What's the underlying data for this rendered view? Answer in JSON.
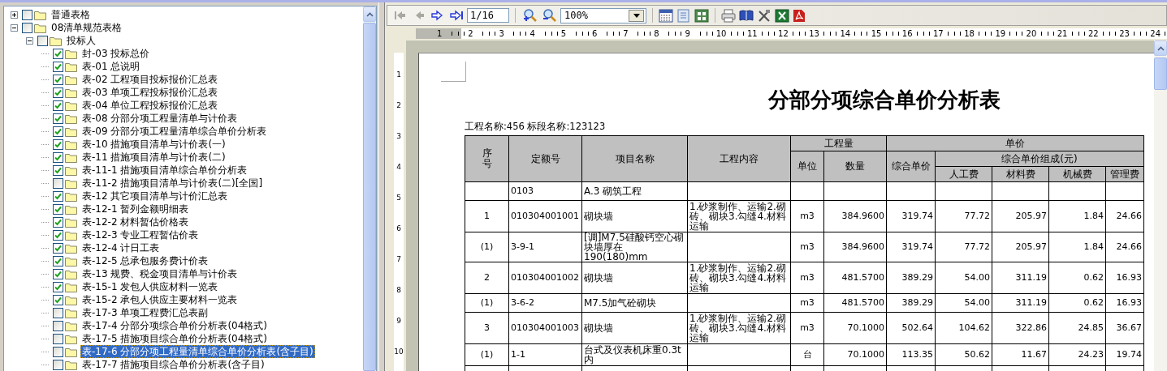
{
  "tree": {
    "items": [
      {
        "label": "普通表格",
        "expanded": false,
        "checked": false,
        "selected": false
      },
      {
        "label": "08清单规范表格",
        "expanded": true,
        "checked": false,
        "selected": false,
        "children": [
          {
            "label": "投标人",
            "expanded": true,
            "checked": false,
            "selected": false,
            "children": [
              {
                "label": "封-03 投标总价",
                "checked": true,
                "selected": false
              },
              {
                "label": "表-01 总说明",
                "checked": true,
                "selected": false
              },
              {
                "label": "表-02 工程项目投标报价汇总表",
                "checked": true,
                "selected": false
              },
              {
                "label": "表-03 单项工程投标报价汇总表",
                "checked": true,
                "selected": false
              },
              {
                "label": "表-04 单位工程投标报价汇总表",
                "checked": true,
                "selected": false
              },
              {
                "label": "表-08 分部分项工程量清单与计价表",
                "checked": true,
                "selected": false
              },
              {
                "label": "表-09 分部分项工程量清单综合单价分析表",
                "checked": true,
                "selected": false
              },
              {
                "label": "表-10 措施项目清单与计价表(一)",
                "checked": true,
                "selected": false
              },
              {
                "label": "表-11 措施项目清单与计价表(二)",
                "checked": true,
                "selected": false
              },
              {
                "label": "表-11-1 措施项目清单综合单价分析表",
                "checked": true,
                "selected": false
              },
              {
                "label": "表-11-2 措施项目清单与计价表(二)[全国]",
                "checked": false,
                "selected": false
              },
              {
                "label": "表-12 其它项目清单与计价汇总表",
                "checked": true,
                "selected": false
              },
              {
                "label": "表-12-1 暂列金额明细表",
                "checked": true,
                "selected": false
              },
              {
                "label": "表-12-2 材料暂估价格表",
                "checked": true,
                "selected": false
              },
              {
                "label": "表-12-3 专业工程暂估价表",
                "checked": true,
                "selected": false
              },
              {
                "label": "表-12-4 计日工表",
                "checked": true,
                "selected": false
              },
              {
                "label": "表-12-5 总承包服务费计价表",
                "checked": true,
                "selected": false
              },
              {
                "label": "表-13 规费、税金项目清单与计价表",
                "checked": true,
                "selected": false
              },
              {
                "label": "表-15-1 发包人供应材料一览表",
                "checked": true,
                "selected": false
              },
              {
                "label": "表-15-2 承包人供应主要材料一览表",
                "checked": true,
                "selected": false
              },
              {
                "label": "表-17-3 单项工程费汇总表副",
                "checked": false,
                "selected": false
              },
              {
                "label": "表-17-4 分部分项综合单价分析表(04格式)",
                "checked": false,
                "selected": false
              },
              {
                "label": "表-17-5 措施项目综合单价分析表(04格式)",
                "checked": false,
                "selected": false
              },
              {
                "label": "表-17-6 分部分项工程量清单综合单价分析表(含子目)",
                "checked": false,
                "selected": true
              },
              {
                "label": "表-17-7 措施项目综合单价分析表(含子目)",
                "checked": false,
                "selected": false
              }
            ]
          }
        ]
      }
    ]
  },
  "toolbar": {
    "nav_buttons": [
      {
        "disabled": true
      },
      {
        "disabled": true
      },
      {
        "disabled": false
      },
      {
        "disabled": false
      }
    ],
    "page_field": {
      "value": "1/16"
    },
    "zoom_select": {
      "value": "100%"
    }
  },
  "ruler": {
    "marks": [
      "1",
      "2",
      "3",
      "4",
      "5",
      "6",
      "7",
      "8",
      "9",
      "10",
      "11",
      "12",
      "13",
      "14",
      "15",
      "16",
      "17",
      "18",
      "19",
      "20",
      "21",
      "22",
      "23",
      "24"
    ]
  },
  "vertical_ruler": {
    "marks": [
      "1",
      "2",
      "3",
      "4",
      "5",
      "6",
      "7",
      "8",
      "9",
      "10"
    ]
  },
  "report": {
    "title": "分部分项综合单价分析表",
    "info": "工程名称:456 标段名称:123123",
    "columns": [
      {
        "label": "序号"
      },
      {
        "label": "定额号"
      },
      {
        "label": "项目名称"
      },
      {
        "label": "工程内容"
      },
      {
        "label": "工程量",
        "children": [
          {
            "label": "单位"
          },
          {
            "label": "数量"
          }
        ]
      },
      {
        "label": "单价",
        "children": [
          {
            "label": "综合单价"
          },
          {
            "label": "综合单价组成(元)",
            "children": [
              {
                "label": "人工费"
              },
              {
                "label": "材料费"
              },
              {
                "label": "机械费"
              },
              {
                "label": "管理费"
              }
            ]
          }
        ]
      }
    ],
    "rows": [
      {
        "code": "0103",
        "name": "A.3 砌筑工程"
      },
      {
        "seq": "1",
        "code": "010304001001",
        "name": "砌块墙",
        "content": "1.砂浆制作、运输2.砌砖、砌块3.勾缝4.材料运输",
        "unit": "m3",
        "qty": "384.9600",
        "price": "319.74",
        "labor": "77.72",
        "material": "205.97",
        "machine": "1.84",
        "mgmt": "24.66"
      },
      {
        "seq": "(1)",
        "code": "3-9-1",
        "name": "[调]M7.5硅酸钙空心砌块墙厚在190(180)mm",
        "unit": "m3",
        "qty": "384.9600",
        "price": "319.74",
        "labor": "77.72",
        "material": "205.97",
        "machine": "1.84",
        "mgmt": "24.66"
      },
      {
        "seq": "2",
        "code": "010304001002",
        "name": "砌块墙",
        "content": "1.砂浆制作、运输2.砌砖、砌块3.勾缝4.材料运输",
        "unit": "m3",
        "qty": "481.5700",
        "price": "389.29",
        "labor": "54.00",
        "material": "311.19",
        "machine": "0.62",
        "mgmt": "16.93"
      },
      {
        "seq": "(1)",
        "code": "3-6-2",
        "name": "M7.5加气砼砌块",
        "unit": "m3",
        "qty": "481.5700",
        "price": "389.29",
        "labor": "54.00",
        "material": "311.19",
        "machine": "0.62",
        "mgmt": "16.93"
      },
      {
        "seq": "3",
        "code": "010304001003",
        "name": "砌块墙",
        "content": "1.砂浆制作、运输2.砌砖、砌块3.勾缝4.材料运输",
        "unit": "m3",
        "qty": "70.1000",
        "price": "502.64",
        "labor": "104.62",
        "material": "322.86",
        "machine": "24.85",
        "mgmt": "36.67"
      },
      {
        "seq": "(1)",
        "code": "1-1",
        "name": "台式及仪表机床重0.3t内",
        "unit": "台",
        "qty": "70.1000",
        "price": "113.35",
        "labor": "50.62",
        "material": "11.67",
        "machine": "24.23",
        "mgmt": "19.74"
      }
    ]
  }
}
